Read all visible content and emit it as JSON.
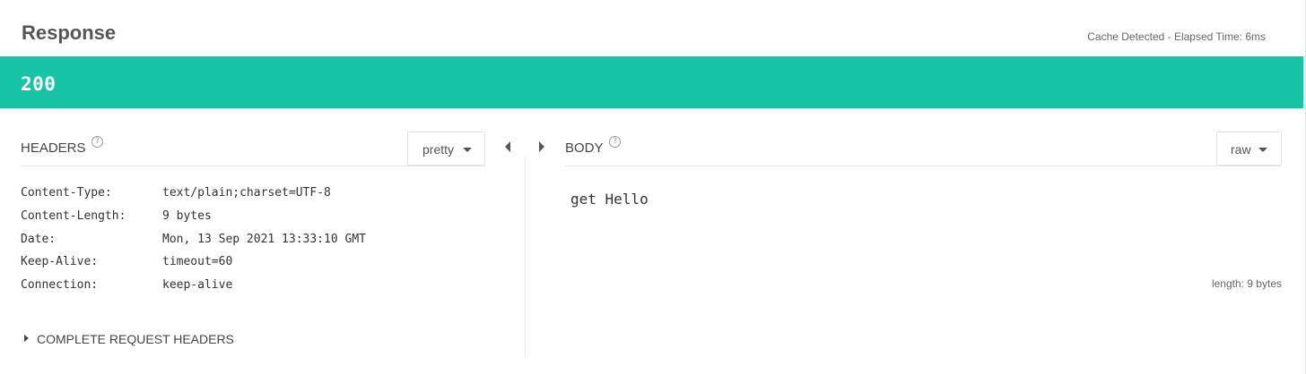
{
  "response": {
    "title": "Response",
    "cache_info": "Cache Detected - Elapsed Time: 6ms",
    "status_code": "200",
    "accent_color": "#17c4a5"
  },
  "headers_panel": {
    "label": "HEADERS",
    "help_icon": "?",
    "format_selected": "pretty",
    "rows": [
      {
        "key": "Content-Type:",
        "value": "text/plain;charset=UTF-8"
      },
      {
        "key": "Content-Length:",
        "value": "9 bytes"
      },
      {
        "key": "Date:",
        "value": "Mon, 13 Sep 2021 13:33:10 GMT"
      },
      {
        "key": "Keep-Alive:",
        "value": "timeout=60"
      },
      {
        "key": "Connection:",
        "value": "keep-alive"
      }
    ],
    "complete_request_headers_label": "COMPLETE REQUEST HEADERS"
  },
  "body_panel": {
    "label": "BODY",
    "help_icon": "?",
    "format_selected": "raw",
    "content": "get Hello",
    "length_info": "length: 9 bytes"
  },
  "icons": {
    "help": "question-circle-icon",
    "collapse_left": "caret-left-icon",
    "expand_right": "caret-right-icon",
    "dropdown": "caret-down-icon",
    "expander": "caret-right-icon"
  }
}
